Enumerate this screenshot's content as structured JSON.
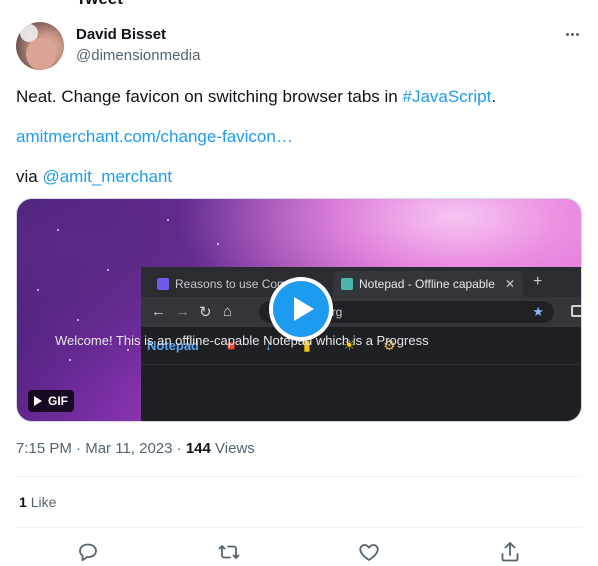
{
  "header": {
    "title": "Tweet"
  },
  "author": {
    "name": "David Bisset",
    "handle": "@dimensionmedia"
  },
  "tweet": {
    "line1_text": "Neat. Change favicon on switching browser tabs in ",
    "line1_hashtag": "#JavaScript",
    "line1_end": ".",
    "link": "amitmerchant.com/change-favicon…",
    "via_prefix": "via ",
    "via_mention": "@amit_merchant"
  },
  "media": {
    "badge": "GIF",
    "browser": {
      "tab1": "Reasons to use Com",
      "tab2": "Notepad - Offline capable",
      "url_fragment": "org",
      "app_name": "Notepad",
      "welcome": "Welcome! This is an offline-capable Notepad which is a Progress"
    }
  },
  "meta": {
    "time": "7:15 PM",
    "date": "Mar 11, 2023",
    "views_count": "144",
    "views_label": "Views"
  },
  "stats": {
    "likes_count": "1",
    "likes_label": "Like"
  },
  "colors": {
    "accent": "#1d9bf0",
    "text": "#0f1419",
    "secondary": "#536471"
  },
  "actions": [
    "reply-icon",
    "retweet-icon",
    "like-icon",
    "share-icon"
  ]
}
